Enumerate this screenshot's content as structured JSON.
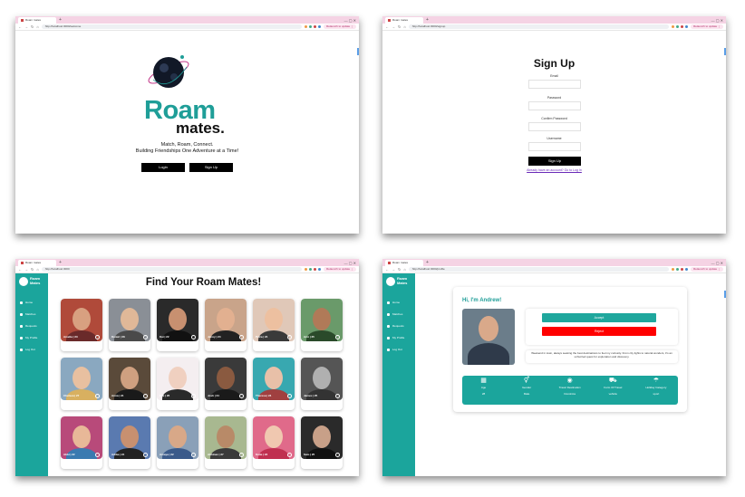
{
  "colors": {
    "accent": "#1ba59c",
    "brand": "#1f9e98",
    "reject": "#ff0000",
    "tabbar": "#f5d3e4"
  },
  "browser": {
    "tab_title": "Roam mates",
    "new_tab_glyph": "+",
    "window_controls": "—  ▢  ✕",
    "nav": {
      "back": "←",
      "forward": "→",
      "reload": "↻",
      "home": "⌂"
    },
    "relaunch": "Relaunch to update ⋮",
    "url_1": "http://localhost:3000/welcome",
    "url_2": "http://localhost:3000/signup",
    "url_3": "http://localhost:3000",
    "url_4": "http://localhost:3000/profile"
  },
  "landing": {
    "brand_line1": "Roam",
    "brand_line2": "mates.",
    "tagline1": "Match, Roam, Connect.",
    "tagline2": "Building Friendships One Adventure at a Time!",
    "login_label": "Login",
    "signup_label": "Sign Up"
  },
  "signup": {
    "title": "Sign Up",
    "email_label": "Email",
    "password_label": "Password",
    "confirm_label": "Confirm Password",
    "username_label": "Username",
    "submit_label": "Sign Up",
    "login_link": "Already have an account? Go to Log In"
  },
  "sidebar": {
    "brand_line1": "Roam",
    "brand_line2": "Mates",
    "items": [
      "Home",
      "Matches",
      "Requests",
      "My Profile",
      "Log Out"
    ]
  },
  "grid": {
    "title": "Find Your Roam Mates!",
    "cards": [
      {
        "caption": "Amelia | 23",
        "skin": "#d8a080",
        "bg": "#b04a3a",
        "shirt": "#6a2a2a"
      },
      {
        "caption": "Daniel | 26",
        "skin": "#e0b898",
        "bg": "#8a8f96",
        "shirt": "#4a4a4a"
      },
      {
        "caption": "Kai | 22",
        "skin": "#c89070",
        "bg": "#2a2a2a",
        "shirt": "#111111"
      },
      {
        "caption": "Jenny | 24",
        "skin": "#e2b090",
        "bg": "#c9a48a",
        "shirt": "#222222"
      },
      {
        "caption": "Petra | 24",
        "skin": "#edc0a0",
        "bg": "#e0c8b8",
        "shirt": "#3a3a3a"
      },
      {
        "caption": "Aziz | 25",
        "skin": "#b07a58",
        "bg": "#6a9a6a",
        "shirt": "#2a4a2a"
      },
      {
        "caption": "Chelsea | 27",
        "skin": "#e8c0a0",
        "bg": "#8aa8c0",
        "shirt": "#d8b060"
      },
      {
        "caption": "Anna | 24",
        "skin": "#cfa080",
        "bg": "#5a4a3a",
        "shirt": "#1a1a1a"
      },
      {
        "caption": "Elle | 26",
        "skin": "#f0d0c0",
        "bg": "#f4eef0",
        "shirt": "#2a2a2a"
      },
      {
        "caption": "Josh | 24",
        "skin": "#8a5a40",
        "bg": "#3a3a3a",
        "shirt": "#1a1a1a"
      },
      {
        "caption": "Theresa | 24",
        "skin": "#e8c0a8",
        "bg": "#38a8b0",
        "shirt": "#a04040"
      },
      {
        "caption": "James | 25",
        "skin": "#b0b0b0",
        "bg": "#555555",
        "shirt": "#333333"
      },
      {
        "caption": "Abbi | 22",
        "skin": "#e8b898",
        "bg": "#b84a7a",
        "shirt": "#3a7ab0"
      },
      {
        "caption": "Adiba | 24",
        "skin": "#c89070",
        "bg": "#5a7ab0",
        "shirt": "#222222"
      },
      {
        "caption": "Amaya | 22",
        "skin": "#d8a888",
        "bg": "#8aa0b8",
        "shirt": "#3a5a8a"
      },
      {
        "caption": "Abhinav | 27",
        "skin": "#b88a68",
        "bg": "#a8b890",
        "shirt": "#3a3a3a"
      },
      {
        "caption": "Katie | 23",
        "skin": "#f0c8b0",
        "bg": "#e06a8a",
        "shirt": "#c03050"
      },
      {
        "caption": "Sam | 25",
        "skin": "#c8a088",
        "bg": "#2a2a2a",
        "shirt": "#111111"
      }
    ]
  },
  "profile": {
    "greeting": "Hi, I'm Andrew!",
    "accept_label": "Accept",
    "reject_label": "Reject",
    "bio": "Weekend in town, always seeking the best destinations to fuel my curiosity. From city lights to natural wonders, it's an unhurried quest for exploration and discovery.",
    "stats": [
      {
        "icon": "calendar-icon",
        "glyph": "▦",
        "label": "Age",
        "value": "28"
      },
      {
        "icon": "gender-icon",
        "glyph": "⚥",
        "label": "Gender",
        "value": "Male"
      },
      {
        "icon": "globe-icon",
        "glyph": "◉",
        "label": "Travel Destination",
        "value": "Dominica"
      },
      {
        "icon": "car-icon",
        "glyph": "⛟",
        "label": "Form Of Travel",
        "value": "vehicle"
      },
      {
        "icon": "umbrella-icon",
        "glyph": "☂",
        "label": "Holiday Category",
        "value": "sport"
      }
    ]
  }
}
